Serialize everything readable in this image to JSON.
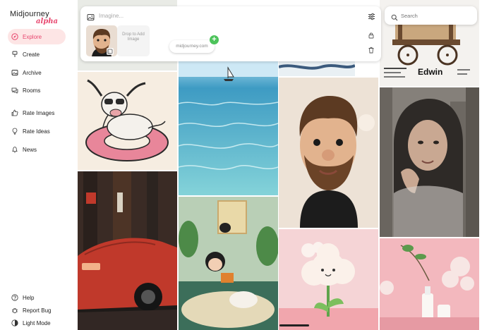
{
  "app": {
    "logo_main": "Midjourney",
    "logo_sub": "alpha"
  },
  "nav": {
    "items": [
      {
        "label": "Explore",
        "icon": "compass-icon",
        "active": true
      },
      {
        "label": "Create",
        "icon": "brush-icon"
      },
      {
        "label": "Archive",
        "icon": "image-icon"
      },
      {
        "label": "Rooms",
        "icon": "chat-icon"
      },
      {
        "label": "Rate Images",
        "icon": "thumbs-up-icon"
      },
      {
        "label": "Rate Ideas",
        "icon": "lightbulb-icon"
      },
      {
        "label": "News",
        "icon": "bell-icon"
      }
    ],
    "bottom": [
      {
        "label": "Help",
        "icon": "help-icon"
      },
      {
        "label": "Report Bug",
        "icon": "bug-icon"
      },
      {
        "label": "Light Mode",
        "icon": "sun-icon"
      }
    ]
  },
  "prompt": {
    "placeholder": "Imagine...",
    "drop_label": "Drop to Add Image",
    "url_chip": "midjourney.com"
  },
  "search": {
    "placeholder": "Search"
  },
  "gallery": {
    "poster_text": "Edwin"
  },
  "colors": {
    "accent": "#e8466e",
    "active_bg": "#fde5e5",
    "plus_green": "#4cc35a"
  }
}
